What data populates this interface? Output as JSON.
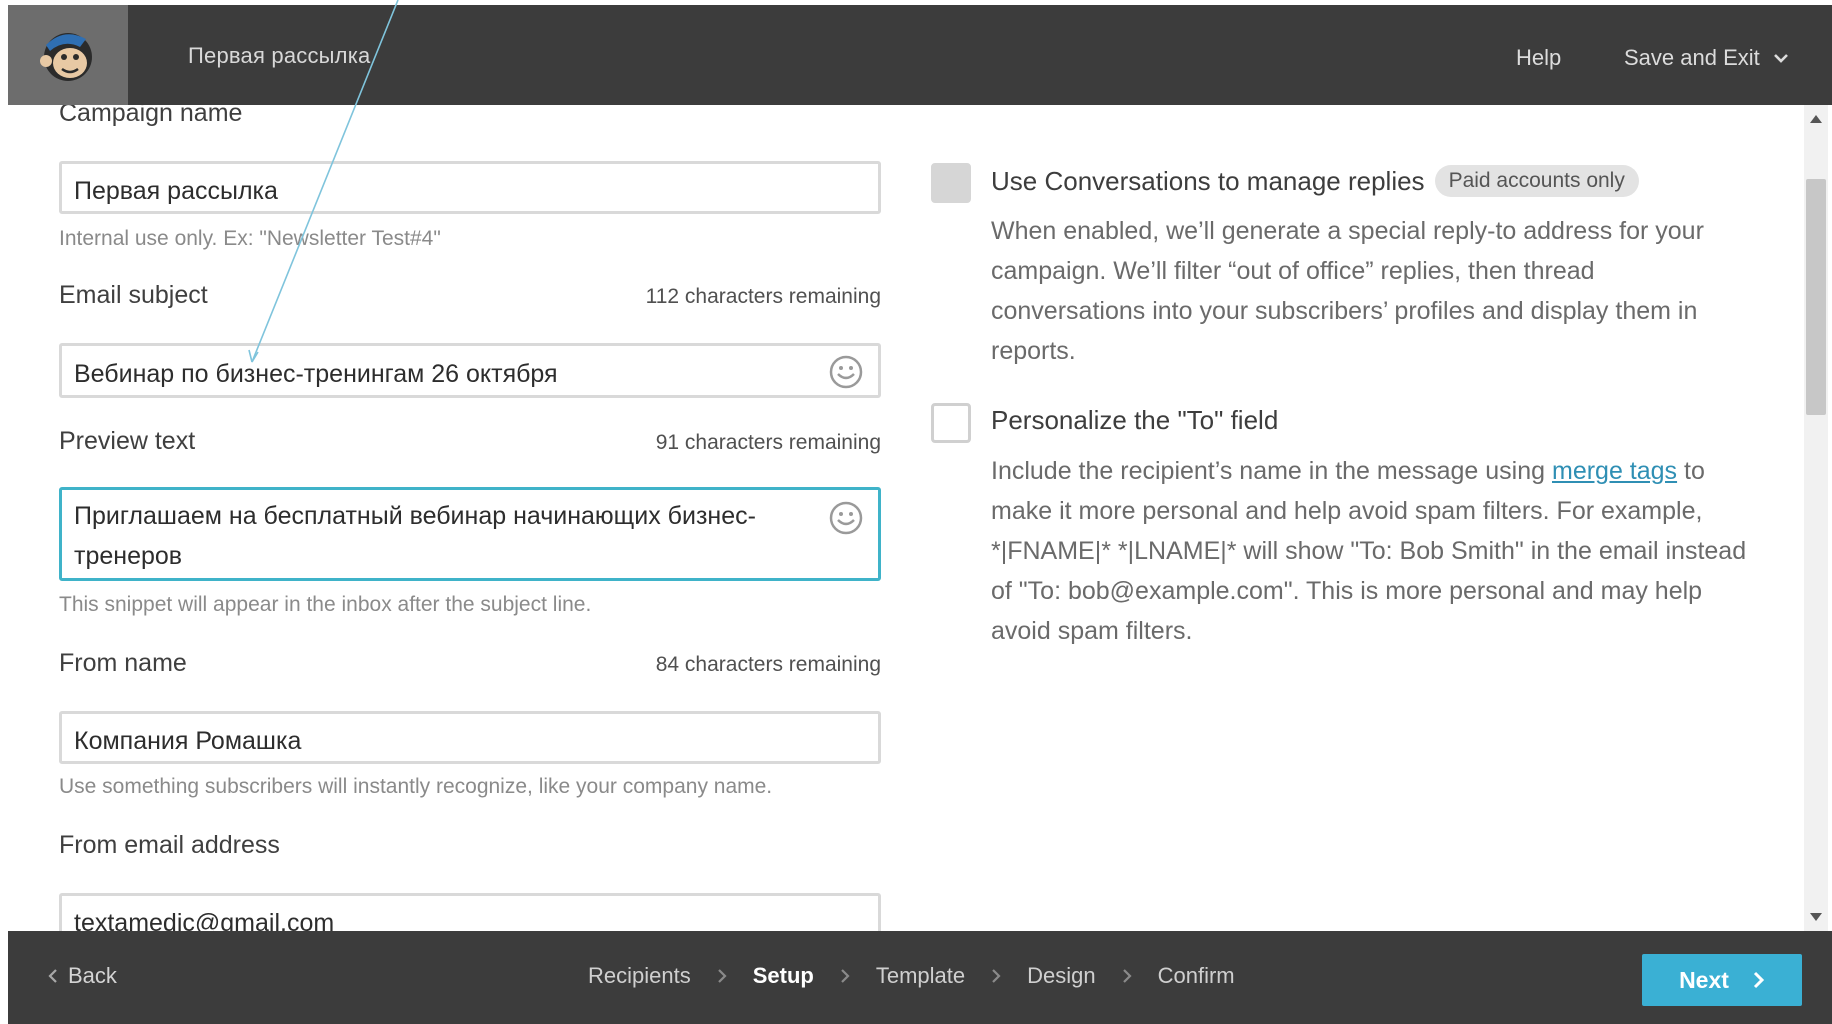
{
  "header": {
    "title": "Первая рассылка",
    "help_label": "Help",
    "save_exit_label": "Save and Exit"
  },
  "form": {
    "campaign_name": {
      "label": "Campaign name",
      "value": "Первая рассылка",
      "hint": "Internal use only. Ex: \"Newsletter Test#4\""
    },
    "email_subject": {
      "label": "Email subject",
      "counter": "112 characters remaining",
      "value": "Вебинар по бизнес-тренингам 26 октября"
    },
    "preview_text": {
      "label": "Preview text",
      "counter": "91 characters remaining",
      "value": "Приглашаем на бесплатный вебинар начинающих бизнес-тренеров",
      "hint": "This snippet will appear in the inbox after the subject line."
    },
    "from_name": {
      "label": "From name",
      "counter": "84 characters remaining",
      "value": "Компания Ромашка",
      "hint": "Use something subscribers will instantly recognize, like your company name."
    },
    "from_email": {
      "label": "From email address",
      "value": "textamedic@gmail.com"
    }
  },
  "options": {
    "conversations": {
      "title": "Use Conversations to manage replies",
      "badge": "Paid accounts only",
      "description": "When enabled, we’ll generate a special reply-to address for your campaign. We’ll filter “out of office” replies, then thread conversations into your subscribers’ profiles and display them in reports.",
      "checked": true
    },
    "personalize": {
      "title": "Personalize the \"To\" field",
      "desc_before": "Include the recipient’s name in the message using ",
      "desc_link": "merge tags",
      "desc_after": " to make it more personal and help avoid spam filters. For example, *|FNAME|* *|LNAME|* will show \"To: Bob Smith\" in the email instead of \"To: bob@example.com\". This is more personal and may help avoid spam filters.",
      "checked": false
    }
  },
  "footer": {
    "back_label": "Back",
    "steps": [
      "Recipients",
      "Setup",
      "Template",
      "Design",
      "Confirm"
    ],
    "active_step": "Setup",
    "next_label": "Next"
  },
  "colors": {
    "bar_background": "#3c3c3c",
    "focus_border": "#3fb3c9",
    "next_button": "#3ab0d4",
    "link": "#2f8fb4"
  },
  "icons": {
    "logo": "chimp-logo-icon",
    "emoji": "smiley-icon",
    "dropdown": "chevron-down-icon",
    "back": "chevron-left-icon",
    "step_separator": "chevron-right-icon",
    "next": "chevron-right-icon"
  }
}
